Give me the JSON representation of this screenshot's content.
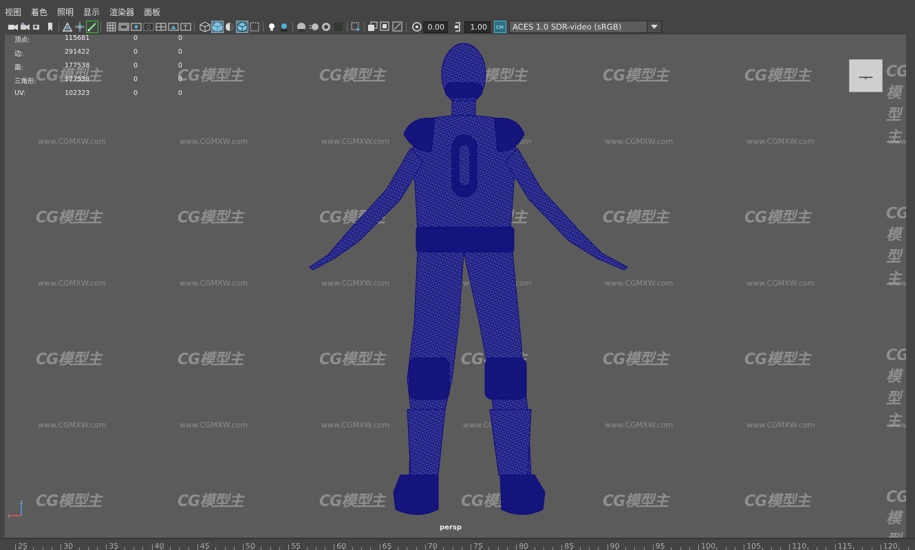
{
  "menu": [
    "视图",
    "着色",
    "照明",
    "显示",
    "渲染器",
    "面板"
  ],
  "toolbar": {
    "gamma_value": "0.00",
    "exposure_value": "1.00",
    "color_management_label": "ACES 1.0 SDR-video (sRGB)"
  },
  "toolbar_icons": [
    "select-camera-icon",
    "camera-attributes-icon",
    "bookmark-icon",
    "image-plane-icon",
    "grease-pencil-icon",
    "grid-icon",
    "film-gate-icon",
    "resolution-gate-icon",
    "gate-mask-icon",
    "field-chart-icon",
    "safe-action-icon",
    "safe-title-icon",
    "wireframe-icon",
    "smooth-shade-icon",
    "default-material-icon",
    "wireframe-on-shaded-icon",
    "xray-icon",
    "xray-joints-icon",
    "use-all-lights-icon",
    "shadows-icon",
    "screen-space-ao-icon",
    "motion-blur-icon",
    "multisample-aa-icon",
    "depth-of-field-icon",
    "isolate-select-icon",
    "texture-icon",
    "camera-pan-zoom-icon",
    "exposure-icon",
    "gamma-icon",
    "color-management-icon"
  ],
  "hud": {
    "rows": [
      {
        "label": "顶点:",
        "a": "115681",
        "b": "0",
        "c": "0"
      },
      {
        "label": "边:",
        "a": "291422",
        "b": "0",
        "c": "0"
      },
      {
        "label": "面:",
        "a": "177538",
        "b": "0",
        "c": "0"
      },
      {
        "label": "三角形:",
        "a": "177538",
        "b": "0",
        "c": "0"
      },
      {
        "label": "UV:",
        "a": "102323",
        "b": "0",
        "c": "0"
      }
    ]
  },
  "watermark": {
    "logo": "CG模型主",
    "url": "www.CGMXW.com"
  },
  "camera_name": "persp",
  "view_cube_label": "ᅮ",
  "axis": {
    "z": "z",
    "x": "x"
  },
  "ruler": [
    "25",
    "30",
    "35",
    "40",
    "45",
    "50",
    "55",
    "60",
    "65",
    "70",
    "75",
    "80",
    "85",
    "90",
    "95",
    "100",
    "105",
    "110",
    "115",
    "120"
  ],
  "colors": {
    "wireframe": "#0d0d8a",
    "viewport_bg": "#5b5b5b",
    "ui_bg": "#444444"
  }
}
